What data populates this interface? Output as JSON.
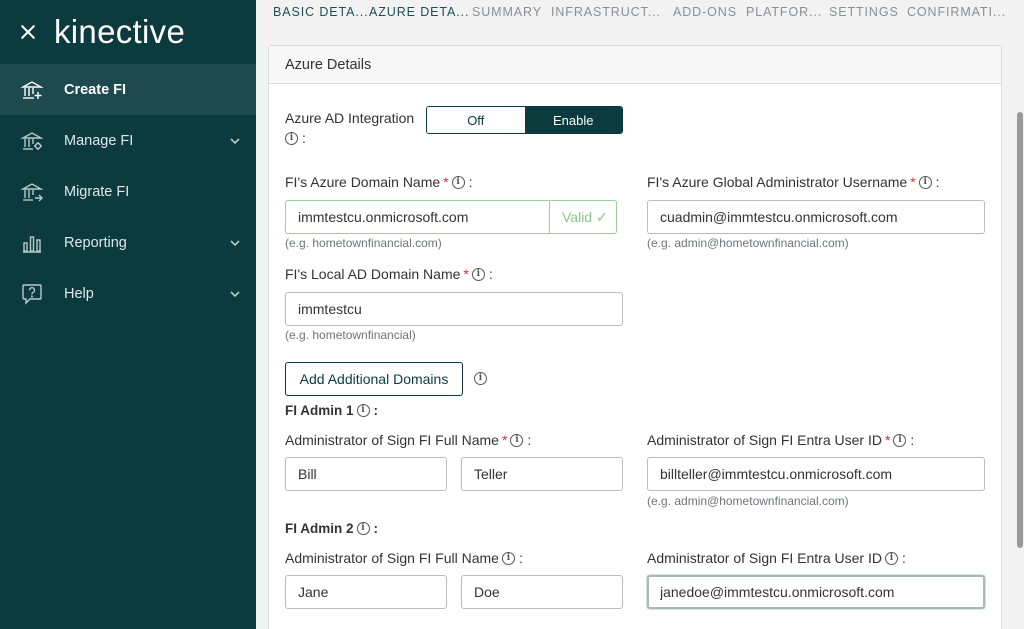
{
  "sidebar": {
    "logo": "kinective",
    "items": [
      {
        "label": "Create FI",
        "icon": "bank-add-icon"
      },
      {
        "label": "Manage FI",
        "icon": "bank-settings-icon"
      },
      {
        "label": "Migrate FI",
        "icon": "bank-migrate-icon"
      },
      {
        "label": "Reporting",
        "icon": "bar-chart-icon"
      },
      {
        "label": "Help",
        "icon": "help-icon"
      }
    ]
  },
  "tabs": [
    "BASIC DETA...",
    "AZURE DETA...",
    "SUMMARY",
    "INFRASTRUCT...",
    "ADD-ONS",
    "PLATFOR...",
    "SETTINGS",
    "CONFIRMATI..."
  ],
  "card": {
    "title": "Azure Details",
    "azure_ad": {
      "label": "Azure AD Integration",
      "colon": ":",
      "off": "Off",
      "enable": "Enable",
      "selected": "Enable"
    },
    "domain": {
      "label": "FI's Azure Domain Name",
      "value": "immtestcu.onmicrosoft.com",
      "valid": "Valid ✓",
      "hint": "(e.g. hometownfinancial.com)"
    },
    "global_admin": {
      "label": "FI's Azure Global Administrator Username",
      "value": "cuadmin@immtestcu.onmicrosoft.com",
      "hint": "(e.g. admin@hometownfinancial.com)"
    },
    "local_ad": {
      "label": "FI's Local AD Domain Name",
      "value": "immtestcu",
      "hint": "(e.g. hometownfinancial)"
    },
    "add_domains": "Add Additional Domains",
    "admin1": {
      "title": "FI Admin 1",
      "name_label": "Administrator of Sign FI Full Name",
      "first": "Bill",
      "last": "Teller",
      "entra_label": "Administrator of Sign FI Entra User ID",
      "entra_value": "billteller@immtestcu.onmicrosoft.com",
      "hint": "(e.g. admin@hometownfinancial.com)"
    },
    "admin2": {
      "title": "FI Admin 2",
      "name_label": "Administrator of Sign FI Full Name",
      "first": "Jane",
      "last": "Doe",
      "entra_label": "Administrator of Sign FI Entra User ID",
      "entra_value": "janedoe@immtestcu.onmicrosoft.com"
    }
  },
  "colors": {
    "sidebar": "#0b3b3f",
    "active_item": "#1d4a4e",
    "required": "#d0342c",
    "valid": "#8cc58c"
  }
}
